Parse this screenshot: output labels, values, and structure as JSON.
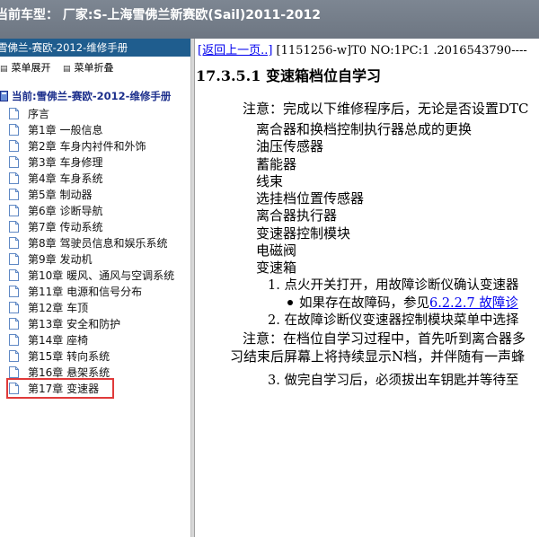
{
  "window": {
    "title": "当前车型：  厂家:S-上海雪佛兰新赛欧(Sail)2011-2012"
  },
  "sidebar": {
    "header": "雪佛兰-赛欧-2012-维修手册",
    "toolbar": {
      "expand_label": "菜单展开",
      "collapse_label": "菜单折叠"
    },
    "root_label": "当前:雪佛兰-赛欧-2012-维修手册",
    "items": [
      {
        "label": "序言"
      },
      {
        "label": "第1章 一般信息"
      },
      {
        "label": "第2章 车身内衬件和外饰"
      },
      {
        "label": "第3章 车身修理"
      },
      {
        "label": "第4章 车身系统"
      },
      {
        "label": "第5章 制动器"
      },
      {
        "label": "第6章 诊断导航"
      },
      {
        "label": "第7章 传动系统"
      },
      {
        "label": "第8章 驾驶员信息和娱乐系统"
      },
      {
        "label": "第9章 发动机"
      },
      {
        "label": "第10章 暖风、通风与空调系统"
      },
      {
        "label": "第11章 电源和信号分布"
      },
      {
        "label": "第12章 车顶"
      },
      {
        "label": "第13章 安全和防护"
      },
      {
        "label": "第14章 座椅"
      },
      {
        "label": "第15章 转向系统"
      },
      {
        "label": "第16章 悬架系统"
      },
      {
        "label": "第17章 变速器"
      }
    ],
    "selected_index": 17,
    "highlight_color": "#e03a3a"
  },
  "content": {
    "back_link": "[返回上一页..]",
    "doc_id": " [1151256-w]T0 NO:1PC:1 .2016543790----",
    "heading": "17.3.5.1 变速箱档位自学习",
    "note1": "注意：完成以下维修程序后，无论是否设置DTC",
    "parts": [
      "离合器和换档控制执行器总成的更换",
      "油压传感器",
      "蓄能器",
      "线束",
      "选挂档位置传感器",
      "离合器执行器",
      "变速器控制模块",
      "电磁阀",
      "变速箱"
    ],
    "step1": "1. 点火开关打开，用故障诊断仪确认变速器",
    "step1_bullet_text": "如果存在故障码，参见",
    "step1_link": "6.2.2.7 故障诊",
    "step2": "2. 在故障诊断仪变速器控制模块菜单中选择",
    "note2_line1": "注意：在档位自学习过程中，首先听到离合器多",
    "note2_line2": "习结束后屏幕上将持续显示N档，并伴随有一声蜂",
    "step3": "3. 做完自学习后，必须拔出车钥匙并等待至"
  }
}
